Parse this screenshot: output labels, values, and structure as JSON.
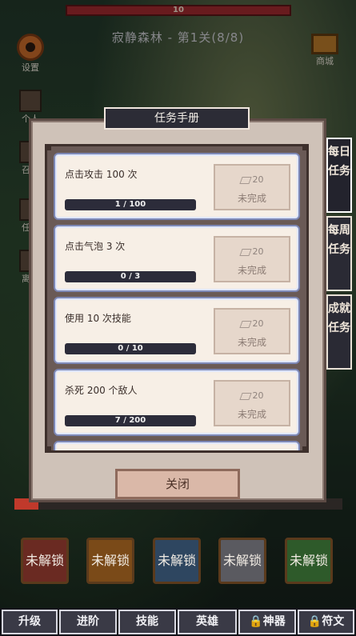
{
  "hud": {
    "hp_value": "10",
    "stage_title": "寂静森林 - 第1关(8/8)"
  },
  "left_menu": {
    "settings": "设置",
    "hero_label": "个人",
    "summon_label": "召唤",
    "task_label": "任务",
    "offline_label": "离线"
  },
  "right_menu": {
    "shop": "商城"
  },
  "modal": {
    "title": "任务手册",
    "close_label": "关闭",
    "tasks": [
      {
        "name": "点击攻击 100 次",
        "progress": "1 / 100",
        "progress_fraction": 0.01,
        "reward": "20",
        "status": "未完成"
      },
      {
        "name": "点击气泡 3 次",
        "progress": "0 / 3",
        "progress_fraction": 0.0,
        "reward": "20",
        "status": "未完成"
      },
      {
        "name": "使用 10 次技能",
        "progress": "0 / 10",
        "progress_fraction": 0.0,
        "reward": "20",
        "status": "未完成"
      },
      {
        "name": "杀死 200 个敌人",
        "progress": "7 / 200",
        "progress_fraction": 0.035,
        "reward": "20",
        "status": "未完成"
      }
    ],
    "tabs": [
      {
        "label": "每日任务",
        "active": true
      },
      {
        "label": "每周任务",
        "active": false
      },
      {
        "label": "成就任务",
        "active": false
      }
    ]
  },
  "skills": [
    {
      "label": "未解锁",
      "color": "#6a2a22"
    },
    {
      "label": "未解锁",
      "color": "#7a4a18"
    },
    {
      "label": "未解锁",
      "color": "#2e4660"
    },
    {
      "label": "未解锁",
      "color": "#5a5a60"
    },
    {
      "label": "未解锁",
      "color": "#2e5a2a"
    }
  ],
  "bottom_nav": [
    {
      "label": "升级",
      "locked": false
    },
    {
      "label": "进阶",
      "locked": false
    },
    {
      "label": "技能",
      "locked": false
    },
    {
      "label": "英雄",
      "locked": false
    },
    {
      "label": "神器",
      "locked": true
    },
    {
      "label": "符文",
      "locked": true
    }
  ]
}
